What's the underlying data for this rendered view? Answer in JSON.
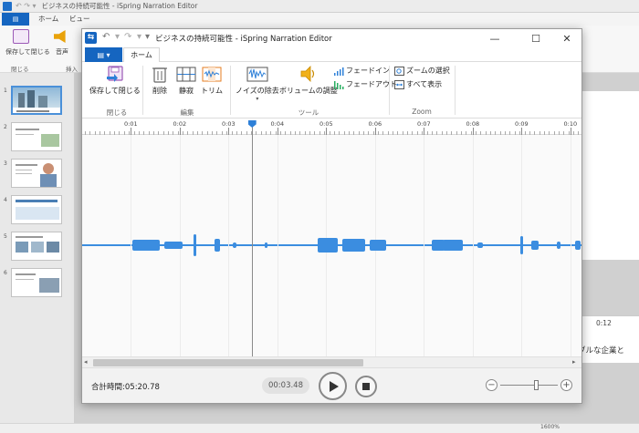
{
  "background_app": {
    "title": "ビジネスの持続可能性 - iSpring Narration Editor",
    "file_tab": "▤",
    "tabs": [
      "ホーム",
      "ビュー"
    ],
    "ribbon": {
      "save_close": "保存して閉じる",
      "audio": "音声",
      "close_group": "閉じる",
      "insert_group": "挿入"
    },
    "slide_numbers": [
      "1",
      "2",
      "3",
      "4",
      "5",
      "6"
    ],
    "timeline_time": "0:12",
    "timeline_text": "ブルな企業と",
    "zoom_level": "1600%"
  },
  "dialog": {
    "title": "ビジネスの持続可能性 - iSpring Narration Editor",
    "file_button": "▤",
    "tabs": [
      "ホーム"
    ],
    "window_buttons": {
      "minimize": "—",
      "maximize": "☐",
      "close": "✕"
    },
    "ribbon": {
      "save_close": "保存して閉じる",
      "delete": "削除",
      "silence": "静寂",
      "trim": "トリム",
      "noise": "ノイズの除去",
      "volume": "ボリュームの調整",
      "fade_in": "フェードイン",
      "fade_out": "フェードアウト",
      "zoom_select": "ズームの選択",
      "show_all": "すべて表示",
      "groups": {
        "close": "閉じる",
        "edit": "編集",
        "tools": "ツール",
        "zoom": "Zoom"
      }
    },
    "ruler_labels": [
      "0:01",
      "0:02",
      "0:03",
      "0:04",
      "0:05",
      "0:06",
      "0:07",
      "0:08",
      "0:09",
      "0:10"
    ],
    "total_time_label": "合計時間:",
    "total_time_value": "05:20.78",
    "current_time": "00:03.48",
    "playhead_position_seconds": 3.48,
    "zoom_slider_fraction": 0.62,
    "colors": {
      "accent": "#1565c0",
      "waveform": "#3b8de0"
    }
  }
}
